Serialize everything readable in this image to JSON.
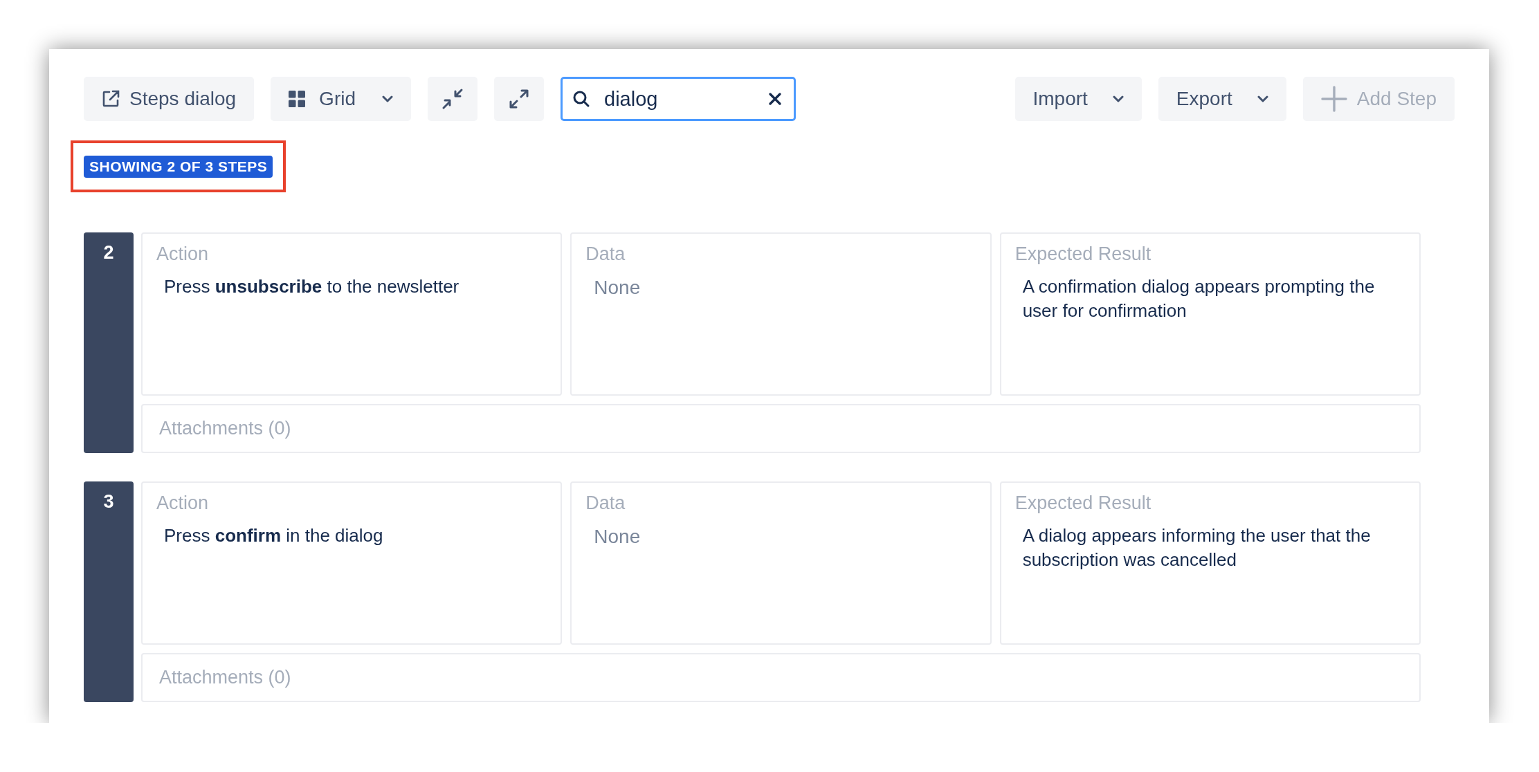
{
  "toolbar": {
    "steps_dialog": "Steps dialog",
    "view": {
      "label": "Grid"
    },
    "search": {
      "value": "dialog"
    },
    "import": "Import",
    "export": "Export",
    "add_step": {
      "label": "Add Step",
      "disabled": true
    }
  },
  "badge": {
    "text": "SHOWING 2 OF 3 STEPS",
    "highlighted": true
  },
  "steps": [
    {
      "number": "2",
      "fields": [
        {
          "label": "Action",
          "value": "Press **unsubscribe** to the newsletter",
          "empty": false
        },
        {
          "label": "Data",
          "value": "None",
          "empty": true
        },
        {
          "label": "Expected Result",
          "value": "A confirmation dialog appears prompting the user for confirmation",
          "empty": false
        }
      ],
      "attachments": "Attachments (0)"
    },
    {
      "number": "3",
      "fields": [
        {
          "label": "Action",
          "value": "Press **confirm** in the dialog",
          "empty": false
        },
        {
          "label": "Data",
          "value": "None",
          "empty": true
        },
        {
          "label": "Expected Result",
          "value": "A dialog appears informing the user that the subscription was cancelled",
          "empty": false
        }
      ],
      "attachments": "Attachments (0)"
    }
  ]
}
